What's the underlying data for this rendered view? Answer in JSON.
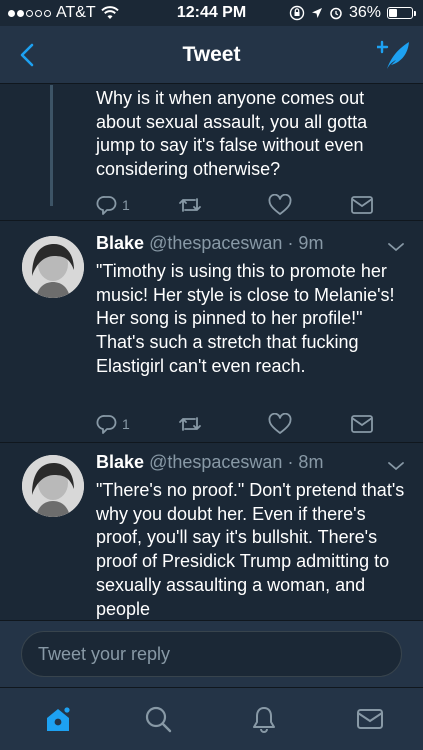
{
  "status_bar": {
    "carrier": "AT&T",
    "time": "12:44 PM",
    "battery": "36%",
    "battery_level": 0.36,
    "signal_bars_filled": 2
  },
  "nav": {
    "title": "Tweet",
    "back_icon": "chevron-left-icon",
    "compose_icon": "compose-tweet-icon"
  },
  "tweets": [
    {
      "text": "Why is it when anyone comes out about sexual assault, you all gotta jump to say it's false without even considering otherwise?",
      "reply_count": "1"
    },
    {
      "name": "Blake",
      "handle": "@thespaceswan",
      "time": "· 9m",
      "text": "\"Timothy is using this to promote her music! Her style is close to Melanie's! Her song is pinned to her profile!\" That's such a stretch that fucking Elastigirl can't even reach.",
      "reply_count": "1"
    },
    {
      "name": "Blake",
      "handle": "@thespaceswan",
      "time": "· 8m",
      "text": "\"There's no proof.\" Don't pretend that's why you doubt her. Even if there's proof, you'll say it's bullshit. There's proof of Presidick Trump admitting to sexually assaulting a woman, and people"
    }
  ],
  "reply": {
    "placeholder": "Tweet your reply"
  },
  "tabs": [
    {
      "icon": "home-icon",
      "active": true
    },
    {
      "icon": "search-icon",
      "active": false
    },
    {
      "icon": "notifications-bell-icon",
      "active": false
    },
    {
      "icon": "messages-envelope-icon",
      "active": false
    }
  ],
  "colors": {
    "accent": "#1da1f2",
    "background": "#1b2836",
    "bar_background": "#243447",
    "secondary_text": "#8899a6"
  }
}
